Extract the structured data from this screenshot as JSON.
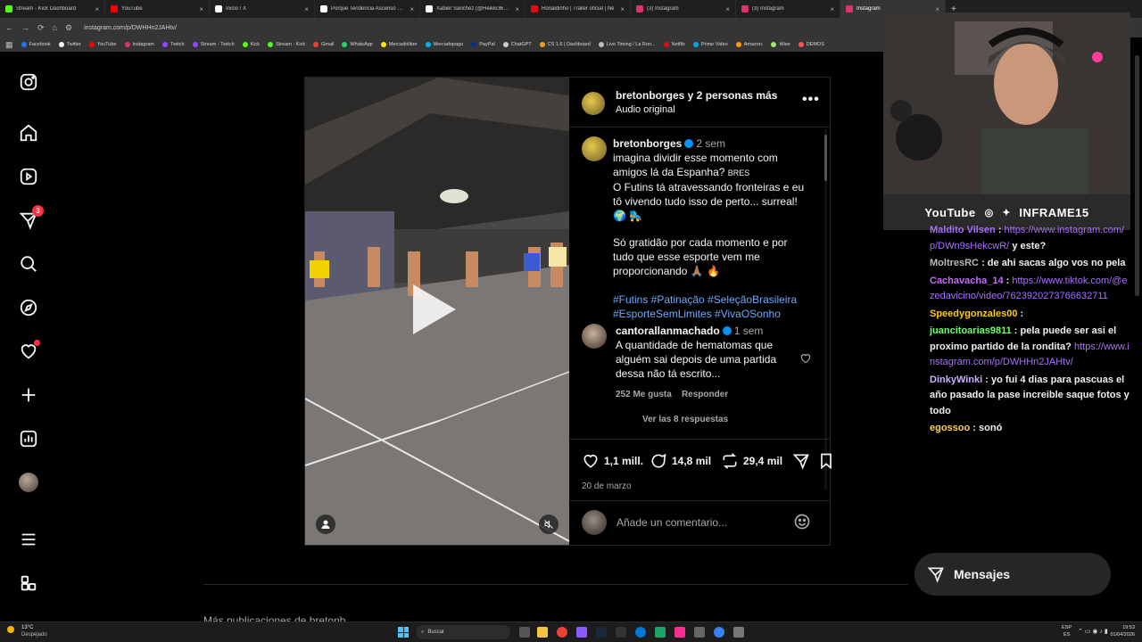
{
  "browser": {
    "tabs": [
      {
        "title": "Stream - Kick Dashboard",
        "color": "#53fc18"
      },
      {
        "title": "YouTube",
        "color": "#ff0000"
      },
      {
        "title": "Inicio / X",
        "color": "#ffffff"
      },
      {
        "title": "Porque Tendencia Ascenso en I",
        "color": "#ffffff"
      },
      {
        "title": "Xabier Sánchez (@Heikki360) /",
        "color": "#ffffff"
      },
      {
        "title": "Ronaldinho | Tráiler oficial | Ne",
        "color": "#e50914"
      },
      {
        "title": "(3) Instagram",
        "color": "#e1306c"
      },
      {
        "title": "(3) Instagram",
        "color": "#e1306c"
      },
      {
        "title": "Instagram",
        "color": "#e1306c"
      }
    ],
    "new_tab": "+",
    "url": "instagram.com/p/DWHHn2JAHtv/",
    "bookmarks": [
      {
        "label": "Facebook",
        "color": "#1877f2"
      },
      {
        "label": "Twitter",
        "color": "#ffffff"
      },
      {
        "label": "YouTube",
        "color": "#ff0000"
      },
      {
        "label": "Instagram",
        "color": "#e1306c"
      },
      {
        "label": "Twitch",
        "color": "#9146ff"
      },
      {
        "label": "Stream - Twitch",
        "color": "#9146ff"
      },
      {
        "label": "Kick",
        "color": "#53fc18"
      },
      {
        "label": "Stream - Kick",
        "color": "#53fc18"
      },
      {
        "label": "Gmail",
        "color": "#ea4335"
      },
      {
        "label": "WhatsApp",
        "color": "#25d366"
      },
      {
        "label": "Mercadolibre",
        "color": "#ffe600"
      },
      {
        "label": "Mercadopago",
        "color": "#00b1ea"
      },
      {
        "label": "PayPal",
        "color": "#003087"
      },
      {
        "label": "ChatGPT",
        "color": "#cccccc"
      },
      {
        "label": "CS 1.6 | Dashboard",
        "color": "#f0a020"
      },
      {
        "label": "Live Timing / La Ron...",
        "color": "#c0c0c0"
      },
      {
        "label": "Netflix",
        "color": "#e50914"
      },
      {
        "label": "Prime Video",
        "color": "#00a8e1"
      },
      {
        "label": "Amazon.",
        "color": "#ff9900"
      },
      {
        "label": "Wise",
        "color": "#9fe870"
      },
      {
        "label": "DEMOS",
        "color": "#ff5555"
      }
    ]
  },
  "nav": {
    "notifications_badge": "3"
  },
  "post": {
    "header_user": "bretonborges y 2 personas más",
    "audio": "Audio original",
    "caption": {
      "user": "bretonborges",
      "time": "2 sem",
      "line1": "imagina dividir esse momento com amigos lá da Espanha?",
      "tag_bres": "BRES",
      "line2": "O Futins tá atravessando fronteiras e eu tô vivendo tudo isso de perto... surreal!",
      "line3": "Só gratidão por cada momento e por tudo que esse esporte vem me proporcionando",
      "hashtags": "#Futins #Patinação #SeleçãoBrasileira #EsporteSemLimites #VivaOSonho"
    },
    "comment": {
      "user": "cantorallanmachado",
      "time": "1 sem",
      "text": "A quantidade de hematomas que alguém sai depois de uma partida dessa não tá escrito...",
      "likes": "252 Me gusta",
      "reply": "Responder",
      "view_replies": "Ver las 8 respuestas"
    },
    "likes": "1,1 mill.",
    "comments": "14,8 mil",
    "reposts": "29,4 mil",
    "date": "20 de marzo",
    "add_comment_placeholder": "Añade un comentario..."
  },
  "stream": {
    "socials": [
      "YouTube",
      "INFRAME15"
    ],
    "chat": [
      {
        "user": "Maldito Vilsen",
        "user_color": "#a970ff",
        "text": "",
        "link": "https://www.instagram.com/p/DWn9sHekcwR/",
        "after": "y este?"
      },
      {
        "user": "MoltresRC",
        "user_color": "#bbbbbb",
        "text": "de ahi sacas algo vos no pela",
        "link": "",
        "after": ""
      },
      {
        "user": "Cachavacha_14",
        "user_color": "#c86bff",
        "text": "",
        "link": "https://www.tiktok.com/@ezedavicino/video/7623920273766632711",
        "after": ""
      },
      {
        "user": "Speedygonzales00",
        "user_color": "#ffcc00",
        "text": "",
        "link": "",
        "after": ""
      },
      {
        "user": "juancitoarias9811",
        "user_color": "#6bff6b",
        "text": "pela puede ser asi el proximo partido de la rondita?",
        "link": "https://www.instagram.com/p/DWHHn2JAHtv/",
        "after": ""
      },
      {
        "user": "DinkyWinki",
        "user_color": "#c8b0ff",
        "text": "yo fui 4 dias para pascuas el año pasado la pase increible saque fotos y todo",
        "link": "",
        "after": ""
      },
      {
        "user": "egossoo",
        "user_color": "#ffd24a",
        "text": "sonó",
        "link": "",
        "after": ""
      }
    ]
  },
  "messages_label": "Mensajes",
  "more_text": "Más publicaciones de bretonb",
  "taskbar": {
    "weather_temp": "13°C",
    "weather_desc": "Despejado",
    "search": "Buscar",
    "lang": "ESP",
    "lang2": "ES",
    "time": "19:53",
    "date": "01/04/2026"
  }
}
